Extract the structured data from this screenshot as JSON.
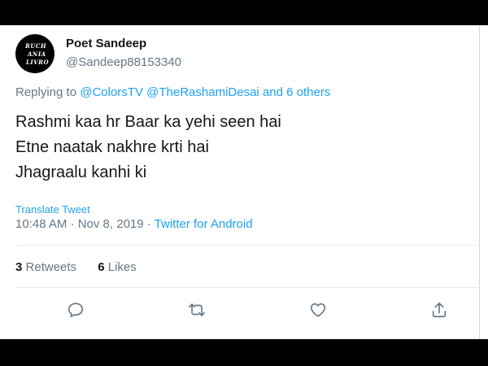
{
  "author": {
    "name": "Poet Sandeep",
    "handle": "@Sandeep88153340",
    "avatar_text": [
      "RUCH",
      "ANIA",
      "LIVRO"
    ]
  },
  "reply": {
    "prefix": "Replying to ",
    "mention1": "@ColorsTV",
    "mention2": "@TheRashamiDesai",
    "suffix": "and 6 others"
  },
  "tweet_lines": [
    "Rashmi kaa hr Baar ka yehi seen hai",
    "Etne naatak nakhre krti hai",
    "Jhagraalu kanhi ki"
  ],
  "translate_label": "Translate Tweet",
  "meta": {
    "time_date": "10:48 AM · Nov 8, 2019 · ",
    "source": "Twitter for Android"
  },
  "stats": {
    "retweets_count": "3",
    "retweets_label": "Retweets",
    "likes_count": "6",
    "likes_label": "Likes"
  },
  "actions": [
    {
      "name": "reply",
      "icon": "comment-icon"
    },
    {
      "name": "retweet",
      "icon": "retweet-icon"
    },
    {
      "name": "like",
      "icon": "heart-icon"
    },
    {
      "name": "share",
      "icon": "share-icon"
    }
  ],
  "colors": {
    "link": "#1da1f2",
    "muted": "#657786",
    "text": "#14171a",
    "frame": "#000000"
  }
}
